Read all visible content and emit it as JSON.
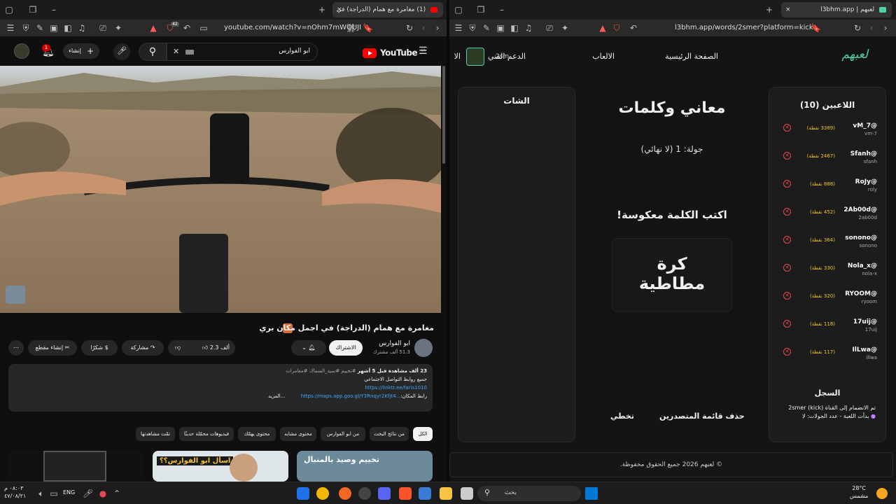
{
  "left_browser": {
    "tab_title": "(1) مغامرة مع همام (الدراجة) في",
    "url": "youtube.com/watch?v=nOhm7mWQUJI",
    "shield_badge": "42"
  },
  "youtube": {
    "logo": "YouTube",
    "logo_region": "SA",
    "search_value": "ابو الفوارس",
    "create_label": "إنشاء",
    "notif_count": "1",
    "video_title": "مغامرة مع همام (الدراجة) في اجمل مكان بري",
    "channel_name": "ابو الفوارس",
    "subscribers": "51.3 ألف مشترك",
    "subscribe_label": "الاشتراك",
    "likes": "2.3 ألف",
    "share_label": "مشاركة",
    "thanks_label": "شكرًا",
    "clip_label": "إنشاء مقطع",
    "desc_stats": "23 ألف مشاهدة قبل 5 أشهر",
    "desc_tags": "#تخييم #سيد_السماك #مغامرات",
    "desc_line1": "جميع روابط التواصل الاجتماعي",
    "desc_link1": "https://linktr.ee/faris1010",
    "desc_location_label": "رابط المكان:",
    "desc_link2": "https://maps.app.goo.gl/Y3Rnqyr2Kfjt4...",
    "desc_more": "...المزيد",
    "chips": [
      "الكل",
      "من نتائج البحث",
      "من ابو الفوارس",
      "محتوى مشابه",
      "محتوى يهمّك",
      "فيديوهات محمّلة حديثًا",
      "تمّت مشاهدتها"
    ],
    "thumb2_text": "اسأل ابو الفوارس؟؟",
    "thumb3_text": "تخييم وصيد بالمنبال"
  },
  "right_browser": {
    "tab_title": "لعبهم | l3bhm.app",
    "url": "l3bhm.app/words/2smer?platform=kick"
  },
  "game": {
    "logo": "لعبهم",
    "nav": [
      "الصفحة الرئيسية",
      "الالعاب",
      "الدعم الفني",
      "الا"
    ],
    "user_tag": "2sm",
    "players_title": "اللاعبين (10)",
    "players": [
      {
        "name": "@vM_7",
        "user": "vm-7",
        "points": "(3389 نقطة)"
      },
      {
        "name": "@Sfanh",
        "user": "sfanh",
        "points": "(2467 نقطة)"
      },
      {
        "name": "@RoJy",
        "user": "roly",
        "points": "(888 نقطة)"
      },
      {
        "name": "@2Ab00d",
        "user": "2ab00d",
        "points": "(452 نقطة)"
      },
      {
        "name": "@sonono",
        "user": "sonono",
        "points": "(364 نقطة)"
      },
      {
        "name": "@Nola_x",
        "user": "nola-x",
        "points": "(330 نقطة)"
      },
      {
        "name": "@RYOOM",
        "user": "ryoom",
        "points": "(320 نقطة)"
      },
      {
        "name": "@17uij",
        "user": "17uij",
        "points": "(118 نقطة)"
      },
      {
        "name": "@IlLwa",
        "user": "illwa",
        "points": "(117 نقطة)"
      }
    ],
    "log_title": "السجل",
    "log_lines": [
      "تم الانضمام إلى القناة 2smer (kick)",
      "بدأت اللعبة - عدد الجولات: لا"
    ],
    "game_title": "معاني وكلمات",
    "round_text": "جولة: 1 (لا نهائي)",
    "instruction": "اكتب الكلمة معكوسة!",
    "word_line1": "كرة",
    "word_line2": "مطاطية",
    "delete_btn": "حذف قائمة المتصدرين",
    "skip_btn": "تخطي",
    "chat_title": "الشات",
    "footer": "© لعبهم 2026 جميع الحقوق محفوظة."
  },
  "taskbar": {
    "search_placeholder": "بحث",
    "lang": "ENG",
    "time": "٠٨:٠٣ م",
    "date": "٤٧/٠٨/٢١",
    "weather_temp": "28°C",
    "weather_desc": "مشمس"
  },
  "colors": {
    "yt_red": "#ff0000",
    "accent_green": "#4fd1a5",
    "gold": "#f4c430",
    "danger": "#e5484d"
  }
}
